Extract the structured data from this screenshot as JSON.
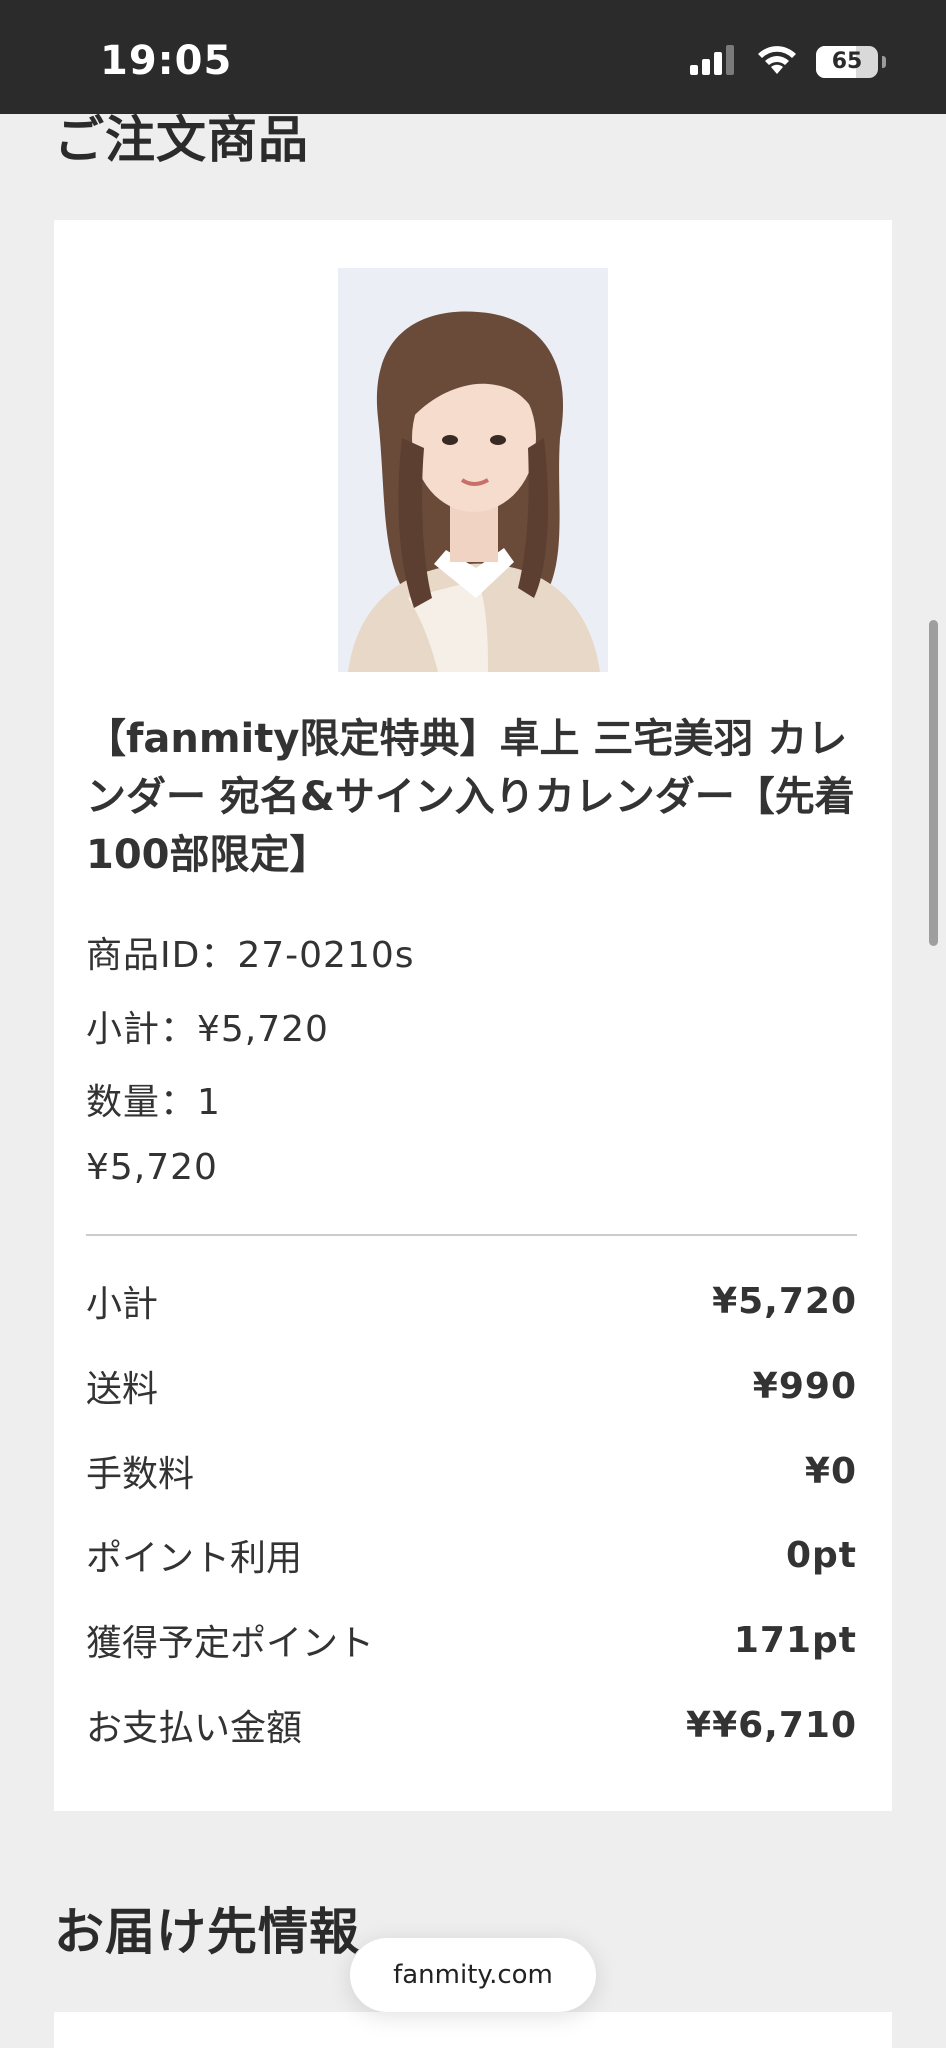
{
  "status_bar": {
    "time": "19:05",
    "battery": "65",
    "battery_level": 0.65,
    "icons": [
      "signal-icon",
      "wifi-icon",
      "battery-icon"
    ]
  },
  "order_section": {
    "title": "ご注文商品"
  },
  "product": {
    "image_name": "product-photo",
    "name": "【fanmity限定特典】卓上 三宅美羽 カレンダー 宛名&サイン入りカレンダー【先着100部限定】",
    "id_line": "商品ID：27-0210s",
    "subtotal_line": "小計：¥5,720",
    "quantity_line": "数量：1",
    "price_line": "¥5,720"
  },
  "summary": {
    "rows": [
      {
        "label": "小計",
        "value": "¥5,720"
      },
      {
        "label": "送料",
        "value": "¥990"
      },
      {
        "label": "手数料",
        "value": "¥0"
      },
      {
        "label": "ポイント利用",
        "value": "0pt"
      },
      {
        "label": "獲得予定ポイント",
        "value": "171pt"
      },
      {
        "label": "お支払い金額",
        "value": "¥¥6,710"
      }
    ]
  },
  "delivery_section": {
    "title": "お届け先情報"
  },
  "browser": {
    "url": "fanmity.com"
  },
  "colors": {
    "status_bar_bg": "#2b2b2b",
    "page_bg": "#eeeeee",
    "card_bg": "#ffffff",
    "text": "#333333"
  }
}
